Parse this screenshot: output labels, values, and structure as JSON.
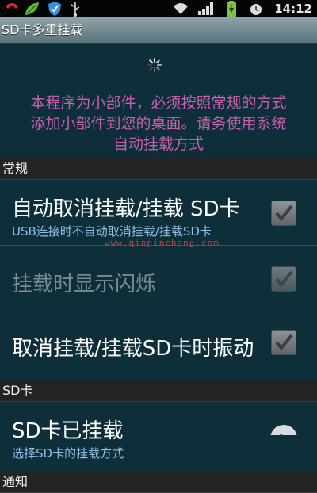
{
  "status_bar": {
    "time": "14:12",
    "icons": [
      "phone-icon",
      "leaf-icon",
      "shield-icon",
      "usb-icon",
      "wifi-icon",
      "signal-icon",
      "battery-charging-icon",
      "alarm-icon"
    ]
  },
  "title_bar": {
    "title": "SD卡多重挂载"
  },
  "notice": {
    "lines": [
      "本程序为小部件，必须按照常规的方式",
      "添加小部件到您的桌面。请务使用系统",
      "自动挂载方式"
    ]
  },
  "categories": {
    "general": "常规",
    "sd_card": "SD卡",
    "notify": "通知"
  },
  "preferences": {
    "auto_unmount": {
      "title": "自动取消挂载/挂载 SD卡",
      "summary": "USB连接时不自动取消挂载/挂载SD卡",
      "checked": true
    },
    "flash_on_mount": {
      "title": "挂载时显示闪烁",
      "checked": true,
      "enabled": false
    },
    "vibrate": {
      "title": "取消挂载/挂载SD卡时振动",
      "checked": true
    },
    "sd_mounted": {
      "title": "SD卡已挂载",
      "summary": "选择SD卡的挂载方式"
    }
  },
  "watermark": "www.qinpinchang.com",
  "colors": {
    "background": "#0e2f3a",
    "notice": "#c55fae",
    "summary": "#8ec0e6",
    "category": "#212325"
  }
}
